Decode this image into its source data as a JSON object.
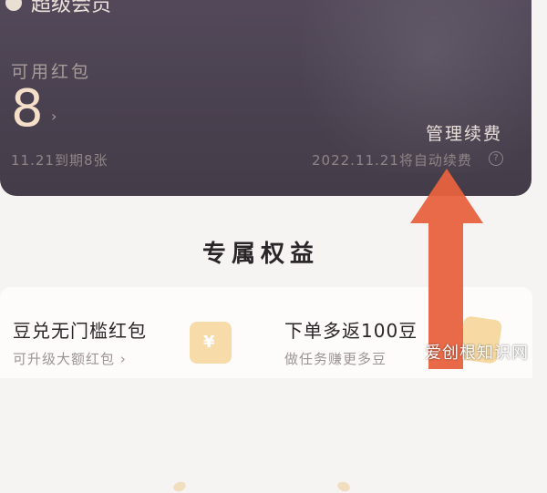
{
  "header": {
    "title_partial": "超级会员"
  },
  "card": {
    "red_packet_label": "可用红包",
    "red_packet_count": "8",
    "chevron": "›",
    "expire_text": "11.21到期8张",
    "manage_label": "管理续费",
    "renew_text": "2022.11.21将自动续费",
    "help_icon": "?"
  },
  "section": {
    "title": "专属权益"
  },
  "benefits": [
    {
      "title": "豆兑无门槛红包",
      "subtitle": "可升级大额红包 ›"
    },
    {
      "title": "下单多返100豆",
      "subtitle": "做任务赚更多豆"
    }
  ],
  "watermark": "爱创根知识网",
  "colors": {
    "card_bg": "#4a4150",
    "accent": "#f6dfc8",
    "arrow": "#e8623f"
  }
}
